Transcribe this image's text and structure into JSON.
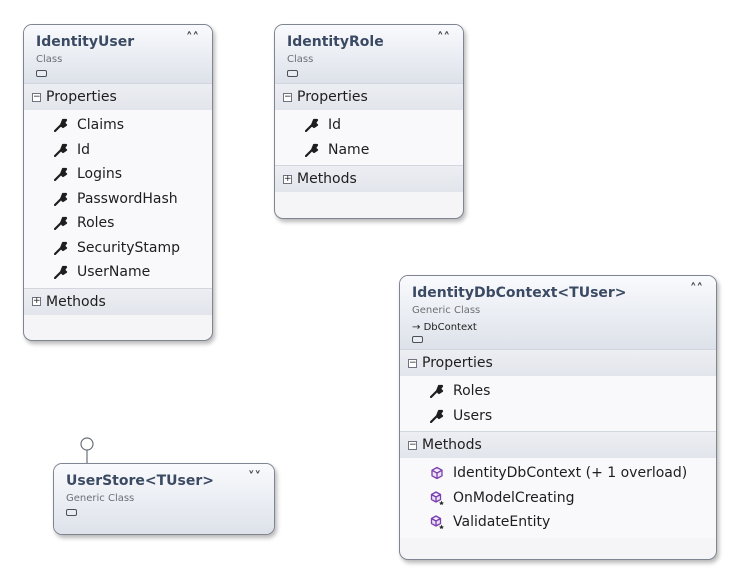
{
  "shapes": {
    "identity_user": {
      "title": "IdentityUser",
      "kind": "Class",
      "properties_label": "Properties",
      "properties": [
        "Claims",
        "Id",
        "Logins",
        "PasswordHash",
        "Roles",
        "SecurityStamp",
        "UserName"
      ],
      "methods_label": "Methods",
      "collapse_icon": "chevron-up"
    },
    "identity_role": {
      "title": "IdentityRole",
      "kind": "Class",
      "properties_label": "Properties",
      "properties": [
        "Id",
        "Name"
      ],
      "methods_label": "Methods",
      "collapse_icon": "chevron-up"
    },
    "identity_db_context": {
      "title": "IdentityDbContext<TUser>",
      "kind": "Generic Class",
      "base_type": "DbContext",
      "properties_label": "Properties",
      "properties": [
        "Roles",
        "Users"
      ],
      "methods_label": "Methods",
      "methods": [
        "IdentityDbContext (+ 1 overload)",
        "OnModelCreating",
        "ValidateEntity"
      ],
      "collapse_icon": "chevron-up"
    },
    "user_store": {
      "title": "UserStore<TUser>",
      "kind": "Generic Class",
      "collapse_icon": "chevron-down"
    }
  },
  "colors": {
    "title": "#3b4a63",
    "border": "#7f8591",
    "method_icon": "#7a3fb0",
    "property_icon": "#1e1e1e"
  }
}
